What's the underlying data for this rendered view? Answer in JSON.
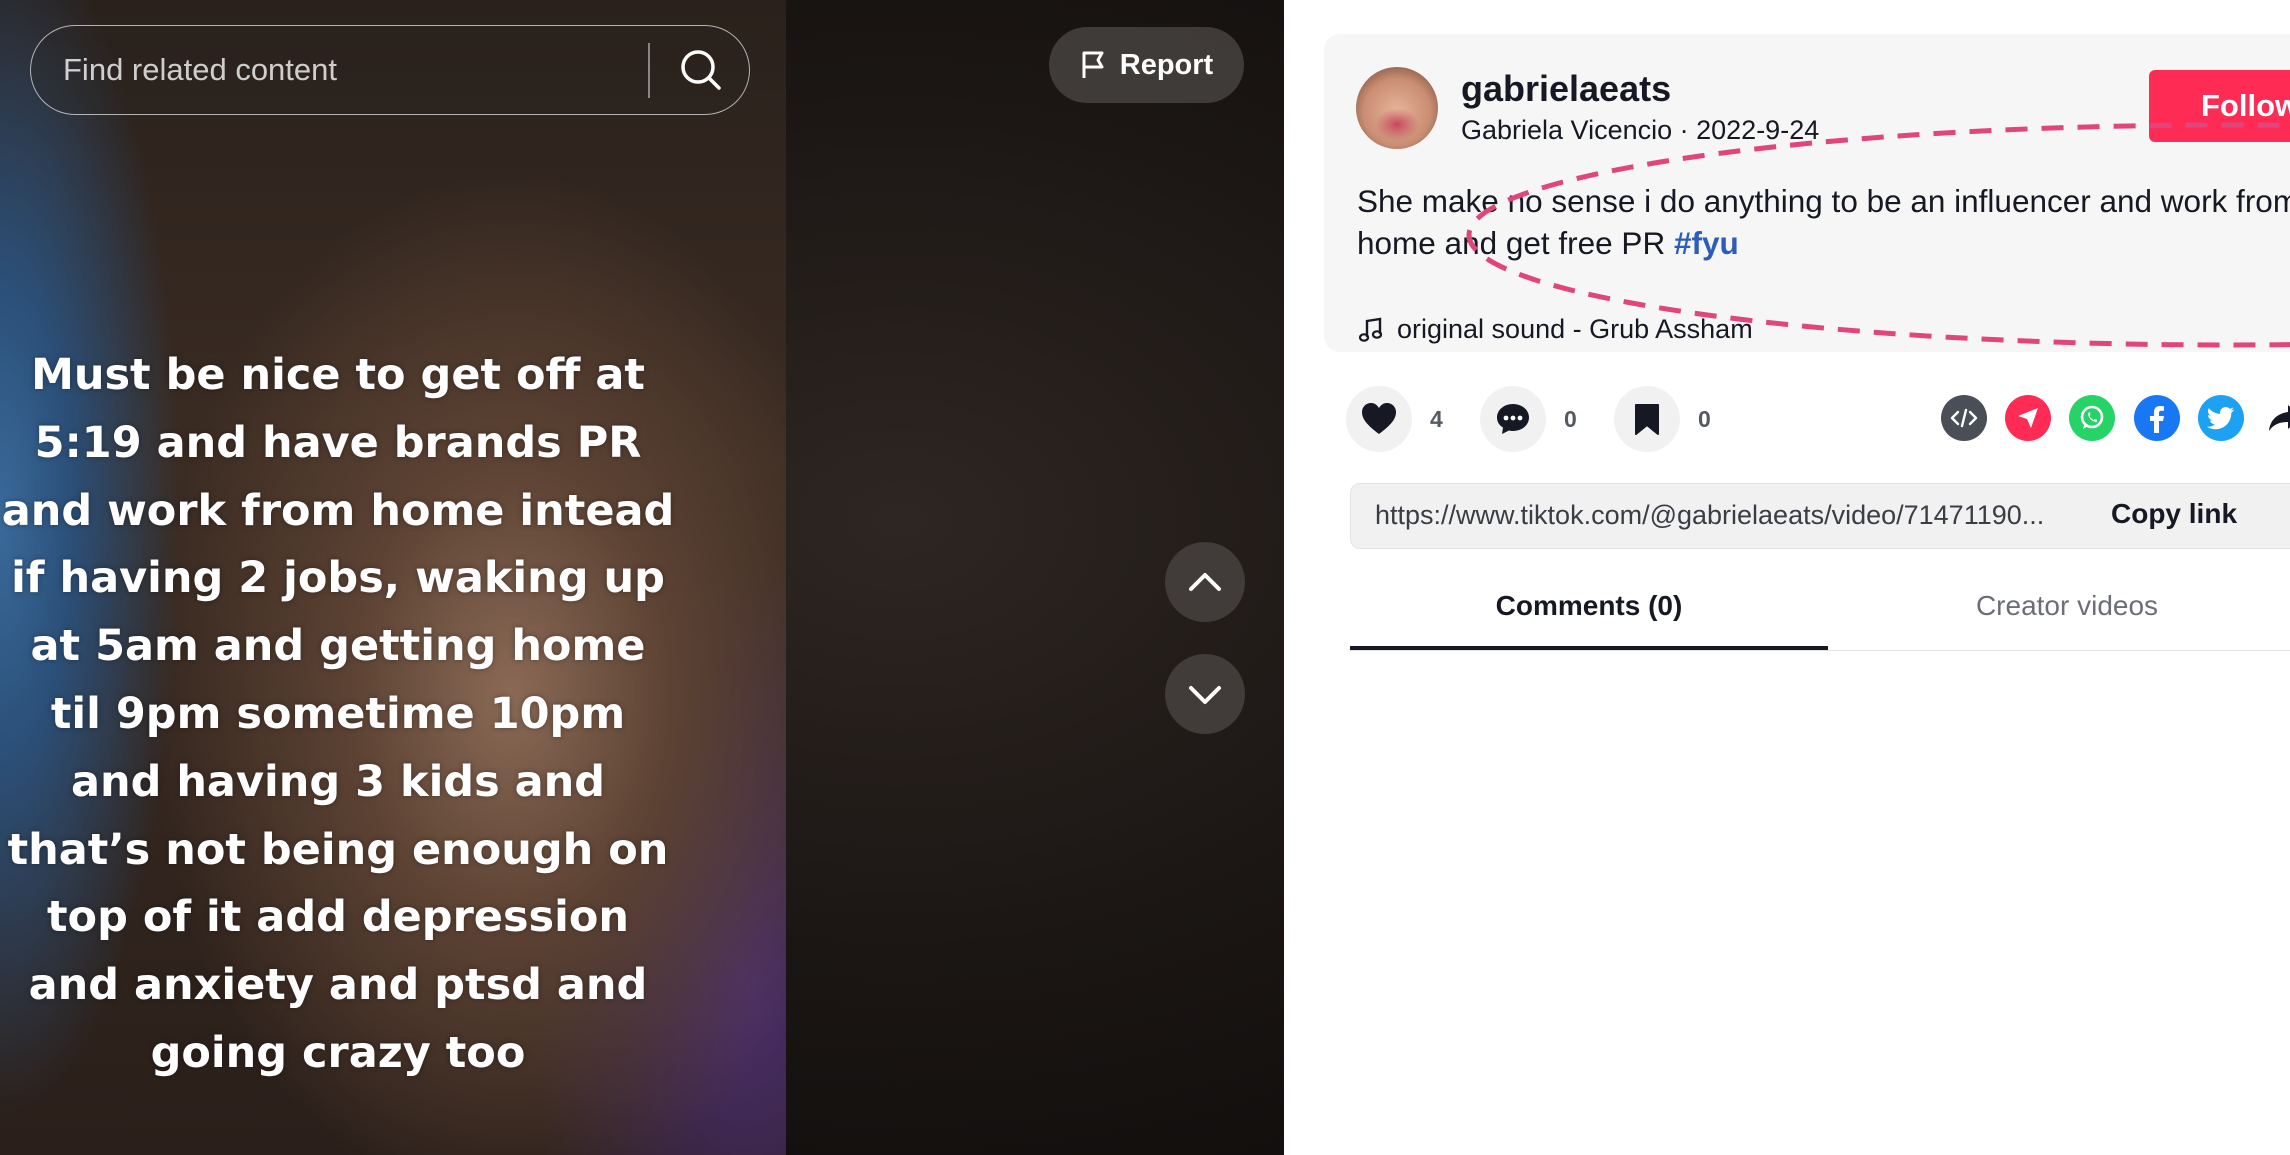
{
  "video": {
    "caption": "Must be nice to get off at 5:19 and have brands PR and work from home intead if having 2 jobs, waking up at 5am and getting home til 9pm sometime 10pm and having 3 kids and that’s not being enough on top of it add depression and anxiety and ptsd and going crazy too",
    "search_placeholder": "Find related content",
    "report_label": "Report"
  },
  "post": {
    "username": "gabrielaeats",
    "display_name": "Gabriela Vicencio",
    "separator": " · ",
    "date": "2022-9-24",
    "follow_label": "Follow",
    "description": "She make no sense i do anything to be an influencer and work from home and get free PR ",
    "hashtag": "#fyu",
    "music": "original sound - Grub Assham"
  },
  "actions": {
    "likes": "4",
    "comments": "0",
    "saves": "0"
  },
  "share": {
    "icons": [
      "embed-icon",
      "send-icon",
      "whatsapp-icon",
      "facebook-icon",
      "twitter-icon",
      "share-arrow-icon"
    ]
  },
  "link": {
    "url": "https://www.tiktok.com/@gabrielaeats/video/71471190...",
    "copy_label": "Copy link"
  },
  "tabs": {
    "comments": "Comments (0)",
    "creator_videos": "Creator videos"
  },
  "colors": {
    "accent": "#fe2c55",
    "hashtag": "#2b5db9",
    "annotation": "#e0457b"
  }
}
